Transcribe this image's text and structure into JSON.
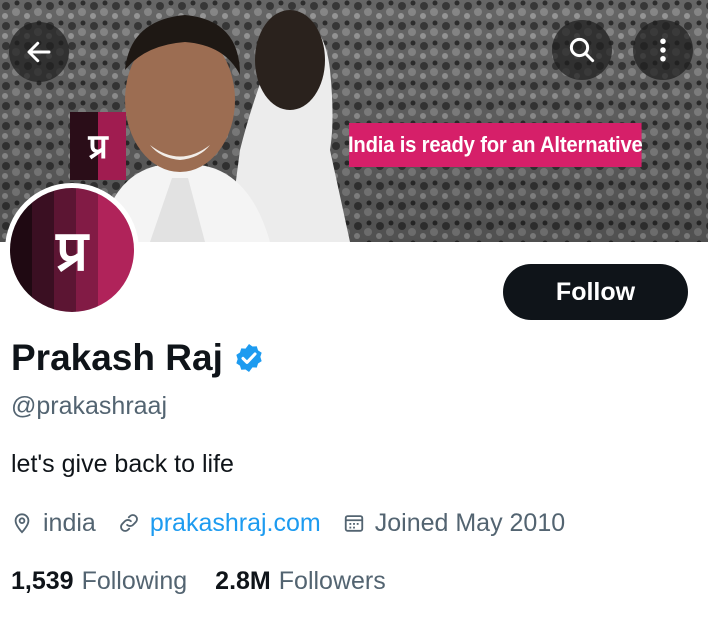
{
  "banner": {
    "tagline": "India is ready for an Alternative",
    "logo_text": "प्र"
  },
  "header_buttons": {
    "back": "back-arrow-icon",
    "search": "search-icon",
    "more": "more-vertical-icon"
  },
  "profile": {
    "avatar_text": "प्र",
    "name": "Prakash Raj",
    "handle": "@prakashraaj",
    "bio": "let's give back to life",
    "location": "india",
    "website": "prakashraj.com",
    "joined": "Joined May 2010",
    "verified": true
  },
  "actions": {
    "follow_label": "Follow"
  },
  "stats": {
    "following_count": "1,539",
    "following_label": "Following",
    "followers_count": "2.8M",
    "followers_label": "Followers"
  },
  "colors": {
    "accent": "#1d9bf0",
    "brand_pink": "#d61f69",
    "text_primary": "#0f1419",
    "text_secondary": "#536471",
    "button_dark": "#0f1419"
  }
}
